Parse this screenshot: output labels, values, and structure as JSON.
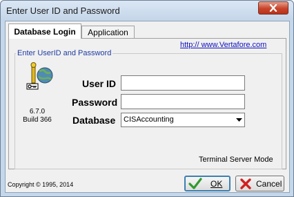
{
  "window": {
    "title": "Enter User ID and Password"
  },
  "tabs": [
    {
      "label": "Database Login",
      "active": true
    },
    {
      "label": "Application",
      "active": false
    }
  ],
  "link_text": "http:// www.Vertafore.com",
  "group_label": "Enter UserID and Password",
  "logo": {
    "version": "6.7.0",
    "build": "Build 366"
  },
  "fields": {
    "user_id_label": "User ID",
    "user_id_value": "",
    "password_label": "Password",
    "password_value": "",
    "database_label": "Database",
    "database_value": "CISAccounting"
  },
  "status_text": "Terminal Server Mode",
  "copyright": "Copyright © 1995, 2014",
  "buttons": {
    "ok_label": "OK",
    "cancel_label": "Cancel"
  },
  "colors": {
    "title_bar": "#c5d7ea",
    "close_button": "#c8432a",
    "link": "#1010c0",
    "group_label": "#1e3ca0"
  }
}
